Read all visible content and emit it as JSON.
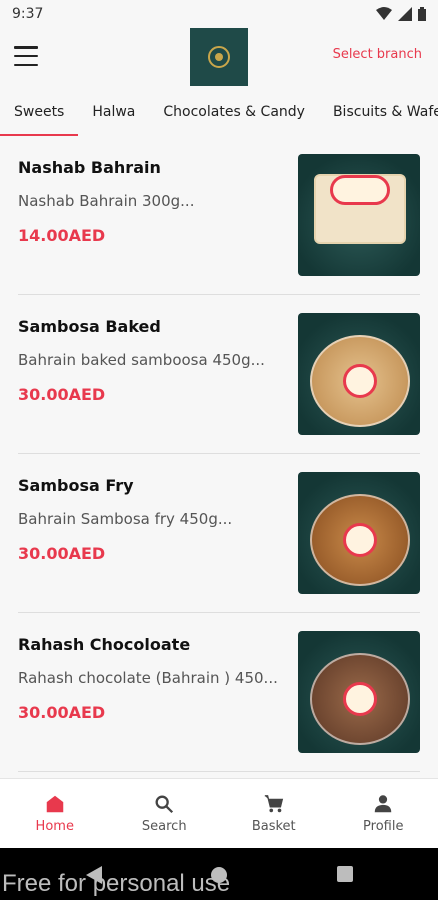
{
  "status_bar": {
    "time": "9:37"
  },
  "header": {
    "select_branch": "Select branch"
  },
  "tabs": [
    {
      "label": "Sweets",
      "active": true
    },
    {
      "label": "Halwa"
    },
    {
      "label": "Chocolates & Candy"
    },
    {
      "label": "Biscuits & Wafer"
    }
  ],
  "products": [
    {
      "name": "Nashab Bahrain",
      "desc": "Nashab Bahrain 300g...",
      "price": "14.00AED"
    },
    {
      "name": "Sambosa Baked",
      "desc": "Bahrain baked samboosa 450g...",
      "price": "30.00AED"
    },
    {
      "name": "Sambosa Fry",
      "desc": "Bahrain Sambosa fry 450g...",
      "price": "30.00AED"
    },
    {
      "name": "Rahash Chocoloate",
      "desc": "Rahash chocolate (Bahrain ) 450...",
      "price": "30.00AED"
    }
  ],
  "bottom_nav": {
    "home": "Home",
    "search": "Search",
    "basket": "Basket",
    "profile": "Profile"
  },
  "watermark": "Free for personal use",
  "colors": {
    "accent": "#e8394d",
    "logo_bg": "#1f4a48",
    "image_bg": "#143735"
  },
  "icons": [
    "menu-icon",
    "wifi-icon",
    "signal-icon",
    "battery-icon",
    "home-icon",
    "search-icon",
    "cart-icon",
    "person-icon"
  ]
}
